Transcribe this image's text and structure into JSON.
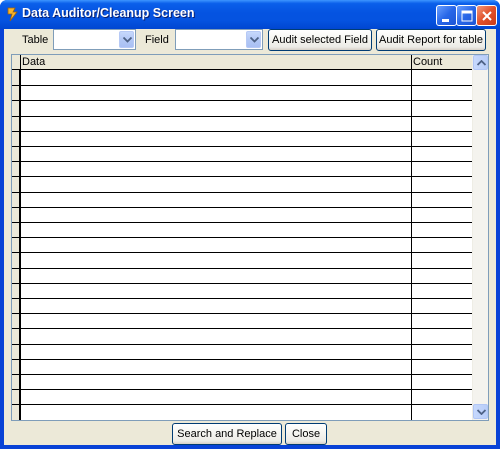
{
  "window": {
    "title": "Data Auditor/Cleanup Screen",
    "icon": "lightning-app-icon"
  },
  "toolbar": {
    "table_label": "Table",
    "table_value": "",
    "field_label": "Field",
    "field_value": "",
    "audit_field_button": "Audit selected Field",
    "audit_report_button": "Audit Report for table"
  },
  "grid": {
    "columns": [
      "Data",
      "Count"
    ],
    "rows": []
  },
  "footer": {
    "search_replace_button": "Search and Replace",
    "close_button": "Close"
  },
  "colors": {
    "titlebar": "#0553e1",
    "client_bg": "#ece9d8",
    "border": "#7f9db9"
  }
}
